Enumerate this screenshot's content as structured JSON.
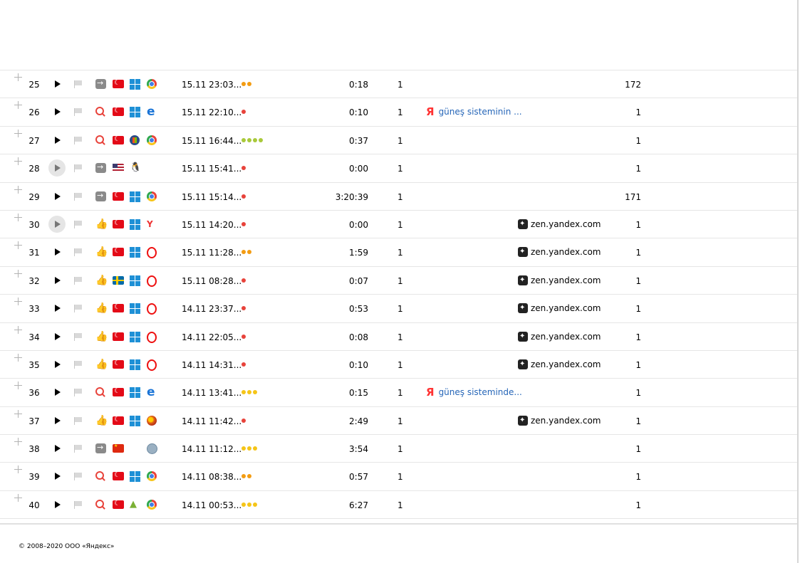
{
  "colors": {
    "red": "#e8433b",
    "orange": "#f39c12",
    "yellow": "#f5c518",
    "green": "#a9c93a",
    "link": "#2666b8"
  },
  "rows": [
    {
      "num": "25",
      "dim": false,
      "src": "arrow-icon",
      "country": "flag-tr",
      "os": "windows-icon",
      "browser": "chrome-icon",
      "time": "15.11 23:03...",
      "dots": [
        "#f39c12",
        "#f39c12"
      ],
      "dur": "0:18",
      "views": "1",
      "search": "",
      "ref": "",
      "count": "172"
    },
    {
      "num": "26",
      "dim": false,
      "src": "search-icon",
      "country": "flag-tr",
      "os": "windows-icon",
      "browser": "edge-icon",
      "time": "15.11 22:10...",
      "dots": [
        "#e8433b"
      ],
      "dur": "0:10",
      "views": "1",
      "search": "güneş sisteminin ...",
      "ref": "",
      "count": "1"
    },
    {
      "num": "27",
      "dim": false,
      "src": "search-icon",
      "country": "flag-tr",
      "os": "windows7-icon",
      "browser": "chrome-icon",
      "time": "15.11 16:44...",
      "dots": [
        "#a9c93a",
        "#a9c93a",
        "#a9c93a",
        "#a9c93a"
      ],
      "dur": "0:37",
      "views": "1",
      "search": "",
      "ref": "",
      "count": "1"
    },
    {
      "num": "28",
      "dim": true,
      "src": "arrow-icon",
      "country": "flag-us",
      "os": "linux-icon",
      "browser": "",
      "time": "15.11 15:41...",
      "dots": [
        "#e8433b"
      ],
      "dur": "0:00",
      "views": "1",
      "search": "",
      "ref": "",
      "count": "1"
    },
    {
      "num": "29",
      "dim": false,
      "src": "arrow-icon",
      "country": "flag-tr",
      "os": "windows-icon",
      "browser": "chrome-icon",
      "time": "15.11 15:14...",
      "dots": [
        "#e8433b"
      ],
      "dur": "3:20:39",
      "views": "1",
      "search": "",
      "ref": "",
      "count": "171"
    },
    {
      "num": "30",
      "dim": true,
      "src": "thumb-icon",
      "country": "flag-tr",
      "os": "windows-icon",
      "browser": "yandex-browser-icon",
      "time": "15.11 14:20...",
      "dots": [
        "#e8433b"
      ],
      "dur": "0:00",
      "views": "1",
      "search": "",
      "ref": "zen.yandex.com",
      "count": "1"
    },
    {
      "num": "31",
      "dim": false,
      "src": "thumb-icon",
      "country": "flag-tr",
      "os": "windows-icon",
      "browser": "opera-icon",
      "time": "15.11 11:28...",
      "dots": [
        "#f39c12",
        "#f39c12"
      ],
      "dur": "1:59",
      "views": "1",
      "search": "",
      "ref": "zen.yandex.com",
      "count": "1"
    },
    {
      "num": "32",
      "dim": false,
      "src": "thumb-icon",
      "country": "flag-se",
      "os": "windows-icon",
      "browser": "opera-icon",
      "time": "15.11 08:28...",
      "dots": [
        "#e8433b"
      ],
      "dur": "0:07",
      "views": "1",
      "search": "",
      "ref": "zen.yandex.com",
      "count": "1"
    },
    {
      "num": "33",
      "dim": false,
      "src": "thumb-icon",
      "country": "flag-tr",
      "os": "windows-icon",
      "browser": "opera-icon",
      "time": "14.11 23:37...",
      "dots": [
        "#e8433b"
      ],
      "dur": "0:53",
      "views": "1",
      "search": "",
      "ref": "zen.yandex.com",
      "count": "1"
    },
    {
      "num": "34",
      "dim": false,
      "src": "thumb-icon",
      "country": "flag-tr",
      "os": "windows-icon",
      "browser": "opera-icon",
      "time": "14.11 22:05...",
      "dots": [
        "#e8433b"
      ],
      "dur": "0:08",
      "views": "1",
      "search": "",
      "ref": "zen.yandex.com",
      "count": "1"
    },
    {
      "num": "35",
      "dim": false,
      "src": "thumb-icon",
      "country": "flag-tr",
      "os": "windows-icon",
      "browser": "opera-icon",
      "time": "14.11 14:31...",
      "dots": [
        "#e8433b"
      ],
      "dur": "0:10",
      "views": "1",
      "search": "",
      "ref": "zen.yandex.com",
      "count": "1"
    },
    {
      "num": "36",
      "dim": false,
      "src": "search-icon",
      "country": "flag-tr",
      "os": "windows-icon",
      "browser": "edge-icon",
      "time": "14.11 13:41...",
      "dots": [
        "#f5c518",
        "#f5c518",
        "#f5c518"
      ],
      "dur": "0:15",
      "views": "1",
      "search": "güneş sisteminde...",
      "ref": "",
      "count": "1"
    },
    {
      "num": "37",
      "dim": false,
      "src": "thumb-icon",
      "country": "flag-tr",
      "os": "windows-icon",
      "browser": "firefox-icon",
      "time": "14.11 11:42...",
      "dots": [
        "#e8433b"
      ],
      "dur": "2:49",
      "views": "1",
      "search": "",
      "ref": "zen.yandex.com",
      "count": "1"
    },
    {
      "num": "38",
      "dim": false,
      "src": "arrow-icon",
      "country": "flag-cn",
      "os": "apple-icon",
      "browser": "safari-icon",
      "time": "14.11 11:12...",
      "dots": [
        "#f5c518",
        "#f5c518",
        "#f5c518"
      ],
      "dur": "3:54",
      "views": "1",
      "search": "",
      "ref": "",
      "count": "1"
    },
    {
      "num": "39",
      "dim": false,
      "src": "search-icon",
      "country": "flag-tr",
      "os": "windows-icon",
      "browser": "chrome-icon",
      "time": "14.11 08:38...",
      "dots": [
        "#f39c12",
        "#f39c12"
      ],
      "dur": "0:57",
      "views": "1",
      "search": "",
      "ref": "",
      "count": "1"
    },
    {
      "num": "40",
      "dim": false,
      "src": "search-icon",
      "country": "flag-tr",
      "os": "android-icon",
      "browser": "chrome-icon",
      "time": "14.11 00:53...",
      "dots": [
        "#f5c518",
        "#f5c518",
        "#f5c518"
      ],
      "dur": "6:27",
      "views": "1",
      "search": "",
      "ref": "",
      "count": "1"
    }
  ],
  "footer": {
    "copyright": "© 2008–2020 ООО «Яндекс»"
  }
}
